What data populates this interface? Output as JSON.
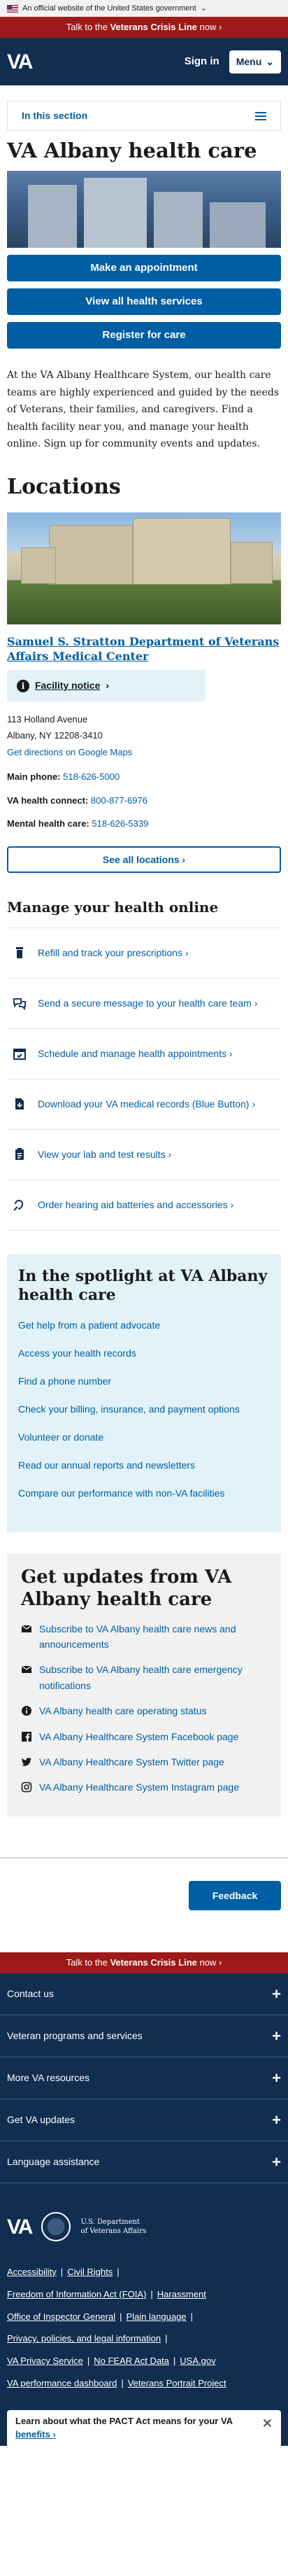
{
  "gov_banner": {
    "text": "An official website of the United States government",
    "chevron": "chevron-down-icon"
  },
  "crisis_line": {
    "prefix": "Talk to the ",
    "emphasis": "Veterans Crisis Line",
    "suffix": " now",
    "arrow": "›"
  },
  "header": {
    "logo": "VA",
    "signin": "Sign in",
    "menu": "Menu",
    "menu_chevron": "⌄"
  },
  "in_this_section": "In this section",
  "page_title": "VA Albany health care",
  "actions": [
    "Make an appointment",
    "View all health services",
    "Register for care"
  ],
  "intro": "At the VA Albany Healthcare System, our health care teams are highly experienced and guided by the needs of Veterans, their families, and caregivers. Find a health facility near you, and manage your health online. Sign up for community events and updates.",
  "locations": {
    "heading": "Locations",
    "facility_name": "Samuel S. Stratton Department of Veterans Affairs Medical Center",
    "notice": "Facility notice",
    "notice_arrow": "›",
    "address_line1": "113 Holland Avenue",
    "address_line2": "Albany, NY 12208-3410",
    "directions": "Get directions on Google Maps",
    "main_phone_label": "Main phone:",
    "main_phone": "518-626-5000",
    "connect_label": "VA health connect:",
    "connect_phone": "800-877-6976",
    "mental_label": "Mental health care:",
    "mental_phone": "518-626-5339",
    "see_all": "See all locations ›"
  },
  "manage": {
    "heading": "Manage your health online",
    "items": [
      {
        "icon": "prescription-bottle-icon",
        "label": "Refill and track your prescriptions ›"
      },
      {
        "icon": "message-bubbles-icon",
        "label": "Send a secure message to your health care team ›"
      },
      {
        "icon": "calendar-icon",
        "label": "Schedule and manage health appointments ›"
      },
      {
        "icon": "download-file-icon",
        "label": "Download your VA medical records (Blue Button) ›"
      },
      {
        "icon": "lab-results-icon",
        "label": "View your lab and test results ›"
      },
      {
        "icon": "hearing-aid-icon",
        "label": "Order hearing aid batteries and accessories ›"
      }
    ]
  },
  "spotlight": {
    "heading": "In the spotlight at VA Albany health care",
    "links": [
      "Get help from a patient advocate",
      "Access your health records",
      "Find a phone number",
      "Check your billing, insurance, and payment options",
      "Volunteer or donate",
      "Read our annual reports and newsletters",
      "Compare our performance with non-VA facilities"
    ]
  },
  "updates": {
    "heading": "Get updates from VA Albany health care",
    "items": [
      {
        "icon": "envelope-icon",
        "label": "Subscribe to VA Albany health care news and announcements"
      },
      {
        "icon": "envelope-icon",
        "label": "Subscribe to VA Albany health care emergency notifications"
      },
      {
        "icon": "info-circle-icon",
        "label": "VA Albany health care operating status"
      },
      {
        "icon": "facebook-icon",
        "label": "VA Albany Healthcare System Facebook page"
      },
      {
        "icon": "twitter-icon",
        "label": "VA Albany Healthcare System Twitter page"
      },
      {
        "icon": "instagram-icon",
        "label": "VA Albany Healthcare System Instagram page"
      }
    ]
  },
  "feedback": "Feedback",
  "footer": {
    "accordion": [
      "Contact us",
      "Veteran programs and services",
      "More VA resources",
      "Get VA updates",
      "Language assistance"
    ],
    "plus": "+",
    "va_logo": "VA",
    "dept_line1": "U.S. Department",
    "dept_line2": "of Veterans Affairs",
    "links": {
      "accessibility": "Accessibility",
      "civil_rights": "Civil Rights",
      "foia": "Freedom of Information Act (FOIA)",
      "harassment": "Harassment",
      "oig": "Office of Inspector General",
      "plain_language": "Plain language",
      "privacy": "Privacy, policies, and legal information",
      "va_privacy": "VA Privacy Service",
      "no_fear": "No FEAR Act Data",
      "usa_gov": "USA.gov",
      "performance": "VA performance dashboard",
      "portrait": "Veterans Portrait Project"
    },
    "pact_text": "Learn about what the PACT Act means for your VA ",
    "pact_link": "benefits ›",
    "pact_close": "✕"
  }
}
